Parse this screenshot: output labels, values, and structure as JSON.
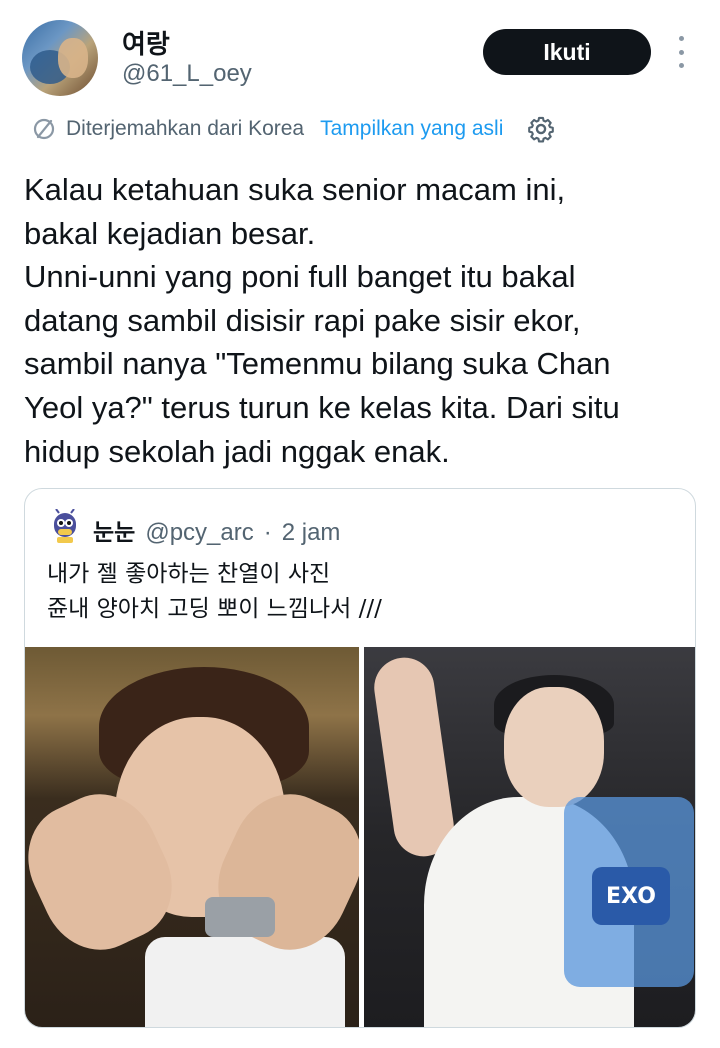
{
  "tweet": {
    "author": {
      "display_name": "여랑",
      "handle": "@61_L_oey"
    },
    "follow_label": "Ikuti",
    "translation": {
      "translated_from": "Diterjemahkan dari Korea",
      "show_original": "Tampilkan yang asli"
    },
    "text": "Kalau ketahuan suka senior macam ini,\nbakal kejadian besar.\nUnni-unni yang poni full banget itu bakal\ndatang sambil disisir rapi pake sisir ekor,\nsambil nanya \"Temenmu bilang suka Chan\nYeol ya?\" terus turun ke kelas kita. Dari situ\nhidup sekolah jadi nggak enak."
  },
  "quote": {
    "display_name": "눈눈",
    "handle": "@pcy_arc",
    "separator": "·",
    "time": "2 jam",
    "text": "내가 젤 좋아하는 찬열이 사진\n쥰내 양아치 고딩 뽀이 느낌나서 ///",
    "media": [
      {
        "name": "photo-left"
      },
      {
        "name": "photo-right",
        "badge_text": "EXO"
      }
    ]
  },
  "icons": {
    "translate": "translate-icon",
    "settings": "gear-icon",
    "more": "more-options-icon"
  },
  "colors": {
    "link": "#1d9bf0",
    "secondary_text": "#536471",
    "follow_bg": "#0f1419",
    "border": "#cfd9de"
  }
}
